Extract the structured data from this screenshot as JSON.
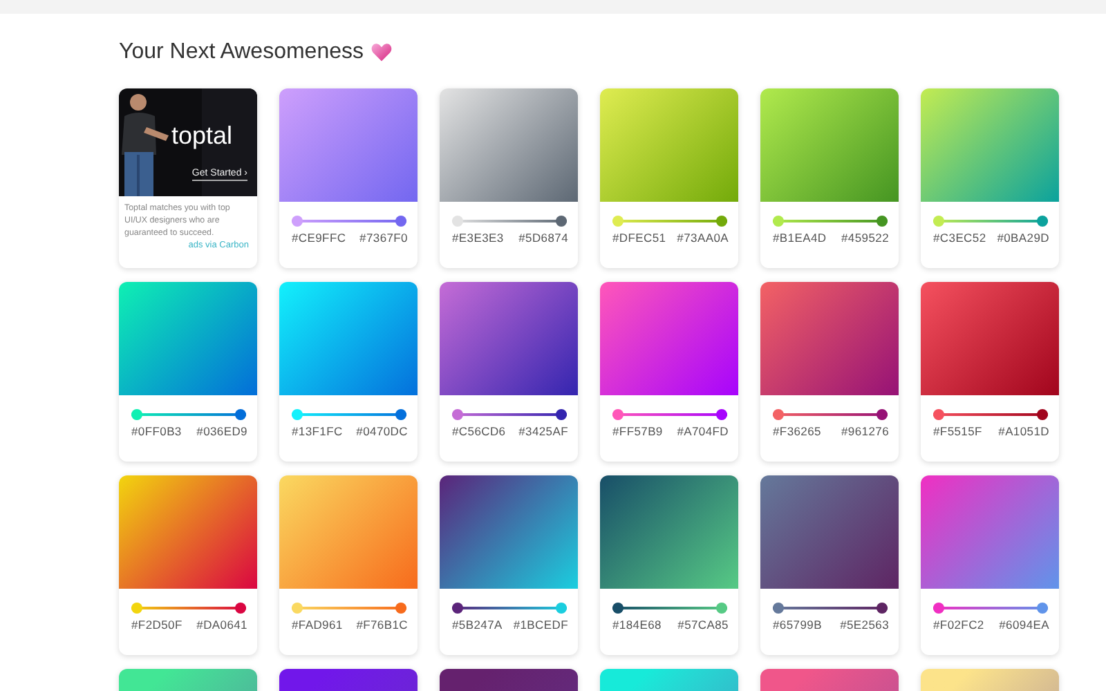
{
  "heading": {
    "text": "Your Next Awesomeness"
  },
  "ad": {
    "brand": "toptal",
    "cta": "Get Started ›",
    "text": "Toptal matches you with top UI/UX designers who are guaranteed to succeed.",
    "link": "ads via Carbon"
  },
  "cards": [
    {
      "from": "#CE9FFC",
      "to": "#7367F0"
    },
    {
      "from": "#E3E3E3",
      "to": "#5D6874"
    },
    {
      "from": "#DFEC51",
      "to": "#73AA0A"
    },
    {
      "from": "#B1EA4D",
      "to": "#459522"
    },
    {
      "from": "#C3EC52",
      "to": "#0BA29D"
    },
    {
      "from": "#0FF0B3",
      "to": "#036ED9"
    },
    {
      "from": "#13F1FC",
      "to": "#0470DC"
    },
    {
      "from": "#C56CD6",
      "to": "#3425AF"
    },
    {
      "from": "#FF57B9",
      "to": "#A704FD"
    },
    {
      "from": "#F36265",
      "to": "#961276"
    },
    {
      "from": "#F5515F",
      "to": "#A1051D"
    },
    {
      "from": "#F2D50F",
      "to": "#DA0641"
    },
    {
      "from": "#FAD961",
      "to": "#F76B1C"
    },
    {
      "from": "#5B247A",
      "to": "#1BCEDF"
    },
    {
      "from": "#184E68",
      "to": "#57CA85"
    },
    {
      "from": "#65799B",
      "to": "#5E2563"
    },
    {
      "from": "#F02FC2",
      "to": "#6094EA"
    },
    {
      "color": "#42E695"
    },
    {
      "color": "#7117EA"
    },
    {
      "color": "#65216E"
    },
    {
      "color": "#17EAD9"
    },
    {
      "color": "#F0568A"
    },
    {
      "color": "#FCE38A"
    }
  ]
}
